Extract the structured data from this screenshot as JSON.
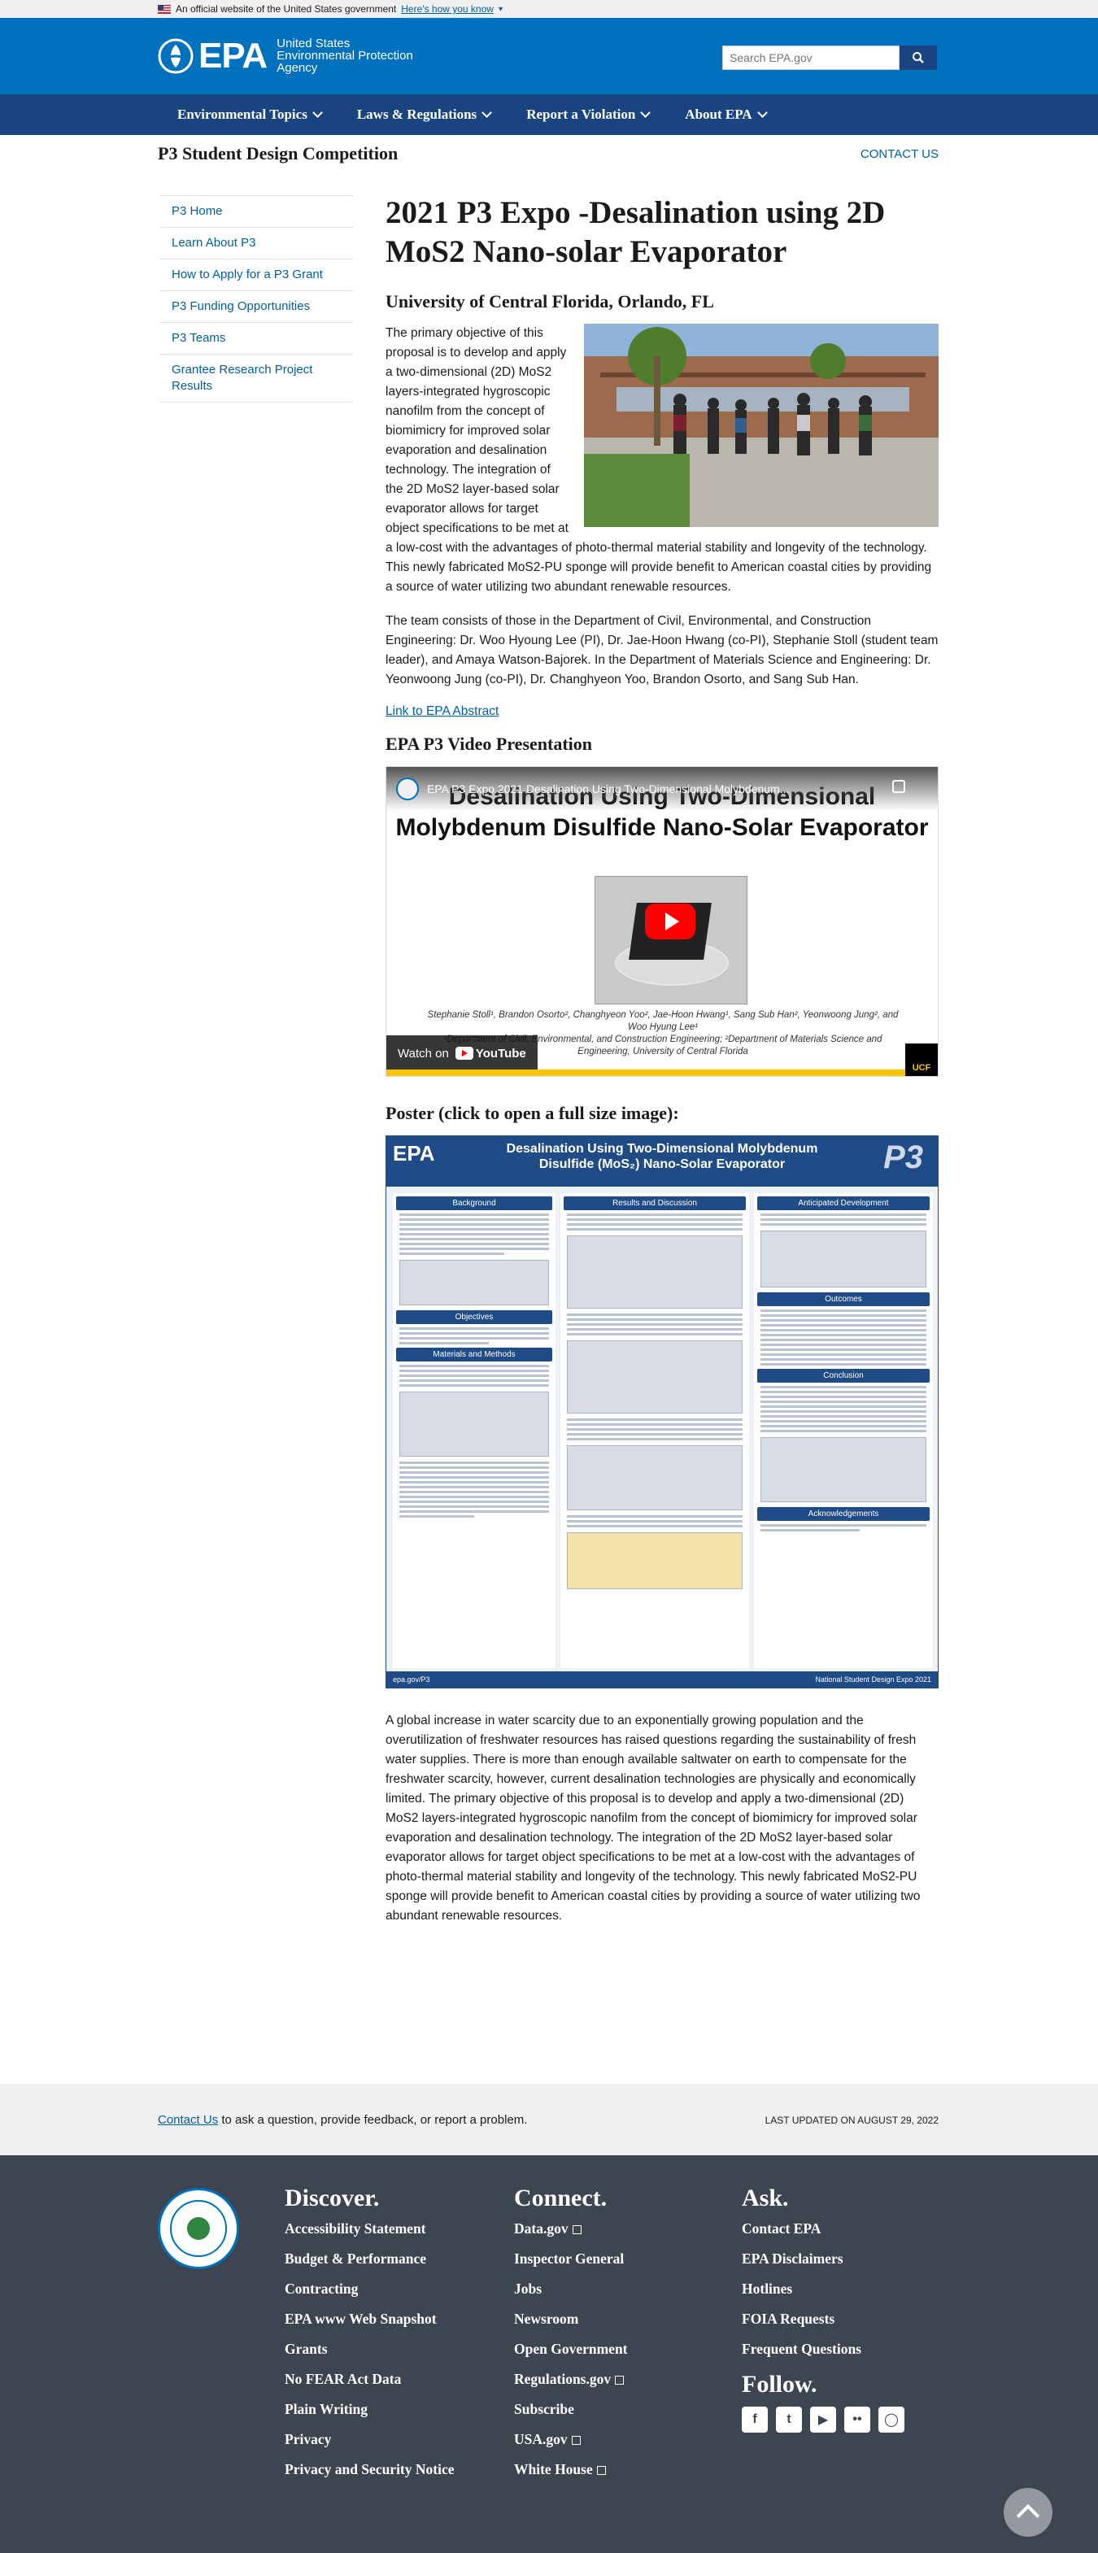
{
  "gov_banner": {
    "text": "An official website of the United States government",
    "link": "Here's how you know"
  },
  "header": {
    "logo_word": "EPA",
    "logo_sub": [
      "United States",
      "Environmental Protection",
      "Agency"
    ],
    "search_placeholder": "Search EPA.gov"
  },
  "nav": {
    "items": [
      "Environmental Topics",
      "Laws & Regulations",
      "Report a Violation",
      "About EPA"
    ]
  },
  "program": {
    "title": "P3 Student Design Competition",
    "contact": "CONTACT US"
  },
  "sidebar": {
    "items": [
      "P3 Home",
      "Learn About P3",
      "How to Apply for a P3 Grant",
      "P3 Funding Opportunities",
      "P3 Teams",
      "Grantee Research Project Results"
    ]
  },
  "main": {
    "title": "2021 P3 Expo -Desalination using 2D MoS2 Nano-solar Evaporator",
    "university": "University of Central Florida, Orlando, FL",
    "para1": "The primary objective of this proposal is to develop and apply a two-dimensional (2D) MoS2 layers-integrated hygroscopic nanofilm from the concept of biomimicry for improved solar evaporation and desalination technology. The integration of the 2D MoS2 layer-based solar evaporator allows for target object specifications to be met at a low-cost with the advantages of photo-thermal material stability and longevity of the technology. This newly fabricated MoS2-PU sponge will provide benefit to American coastal cities by providing a source of water utilizing two abundant renewable resources.",
    "para2": "The team consists of those in the Department of Civil, Environmental, and Construction Engineering: Dr. Woo Hyoung Lee (PI), Dr. Jae-Hoon Hwang (co-PI), Stephanie Stoll (student team leader), and Amaya Watson-Bajorek. In the Department of Materials Science and Engineering: Dr. Yeonwoong Jung (co-PI), Dr. Changhyeon Yoo, Brandon Osorto, and Sang Sub Han.",
    "abstract_link": "Link to EPA Abstract",
    "video_heading": "EPA P3 Video Presentation",
    "poster_heading": "Poster (click to open a full size image):",
    "para3": "A global increase in water scarcity due to an exponentially growing population and the overutilization of freshwater resources has raised questions regarding the sustainability of fresh water supplies. There is more than enough available saltwater on earth to compensate for the freshwater scarcity, however, current desalination technologies are physically and economically limited. The primary objective of this proposal is to develop and apply a two-dimensional (2D) MoS2 layers-integrated hygroscopic nanofilm from the concept of biomimicry for improved solar evaporation and desalination technology. The integration of the 2D MoS2 layer-based solar evaporator allows for target object specifications to be met at a low-cost with the advantages of photo-thermal material stability and longevity of the technology. This newly fabricated MoS2-PU sponge will provide benefit to American coastal cities by providing a source of water utilizing two abundant renewable resources."
  },
  "video": {
    "yt_title": "EPA P3 Expo 2021 Desalination Using Two-Dimensional Molybdenum...",
    "slide_title": "Desalination Using Two-Dimensional Molybdenum Disulfide Nano-Solar Evaporator",
    "authors": "Stephanie Stoll¹, Brandon Osorto², Changhyeon Yoo², Jae-Hoon Hwang¹, Sang Sub Han², Yeonwoong Jung², and Woo Hyung Lee¹",
    "affiliation": "¹Department of Civil, Environmental, and Construction Engineering; ²Department of Materials Science and Engineering, University of Central Florida",
    "watch_on": "Watch on",
    "youtube": "YouTube",
    "ucf": "UCF"
  },
  "poster": {
    "epa": "EPA",
    "title_line1": "Desalination Using Two-Dimensional Molybdenum",
    "title_line2": "Disulfide (MoS₂) Nano-Solar Evaporator",
    "p3": "P3",
    "sections_left": [
      "Background",
      "Objectives",
      "Materials and Methods"
    ],
    "sections_mid": [
      "Results and Discussion"
    ],
    "sections_right": [
      "Anticipated Development",
      "Outcomes",
      "Conclusion",
      "Acknowledgements"
    ],
    "footer_left": "epa.gov/P3",
    "footer_right": "National Student Design Expo 2021"
  },
  "footer": {
    "contact_link": "Contact Us",
    "contact_rest": " to ask a question, provide feedback, or report a problem.",
    "last_updated": "LAST UPDATED ON AUGUST 29, 2022",
    "discover": {
      "heading": "Discover.",
      "items": [
        "Accessibility Statement",
        "Budget & Performance",
        "Contracting",
        "EPA www Web Snapshot",
        "Grants",
        "No FEAR Act Data",
        "Plain Writing",
        "Privacy",
        "Privacy and Security Notice"
      ]
    },
    "connect": {
      "heading": "Connect.",
      "items": [
        "Data.gov",
        "Inspector General",
        "Jobs",
        "Newsroom",
        "Open Government",
        "Regulations.gov",
        "Subscribe",
        "USA.gov",
        "White House"
      ]
    },
    "ask": {
      "heading": "Ask.",
      "items": [
        "Contact EPA",
        "EPA Disclaimers",
        "Hotlines",
        "FOIA Requests",
        "Frequent Questions"
      ]
    },
    "follow": {
      "heading": "Follow."
    }
  }
}
